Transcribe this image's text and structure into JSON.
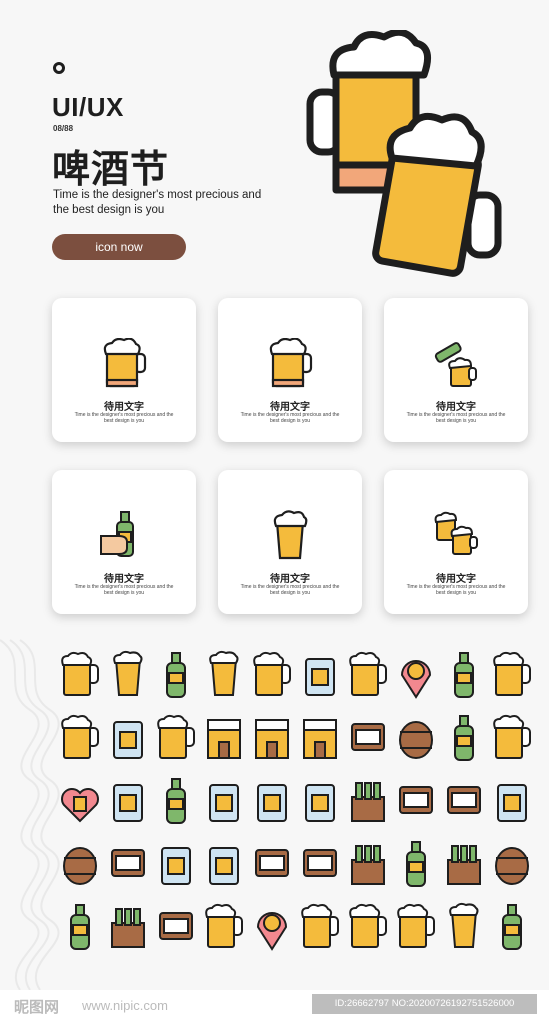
{
  "header": {
    "brand": "UI/UX",
    "count": "08/88",
    "title_cn": "啤酒节",
    "subtitle": "Time is the designer's most precious and the best design is you",
    "button_label": "icon now"
  },
  "cards": [
    {
      "icon": "beer-mug-icon",
      "title": "待用文字",
      "text": "Time is the designer's most precious and the best design is you"
    },
    {
      "icon": "beer-mug-icon",
      "title": "待用文字",
      "text": "Time is the designer's most precious and the best design is you"
    },
    {
      "icon": "bottle-pour-icon",
      "title": "待用文字",
      "text": "Time is the designer's most precious and the best design is you"
    },
    {
      "icon": "hand-bottle-icon",
      "title": "待用文字",
      "text": "Time is the designer's most precious and the best design is you"
    },
    {
      "icon": "beer-glass-icon",
      "title": "待用文字",
      "text": "Time is the designer's most precious and the best design is you"
    },
    {
      "icon": "cheers-icon",
      "title": "待用文字",
      "text": "Time is the designer's most precious and the best design is you"
    }
  ],
  "icon_grid": [
    [
      "beer-mug-icon",
      "tall-glass-icon",
      "bottle-icon",
      "goblet-icon",
      "beer-tap-icon",
      "ice-bucket-icon",
      "beer-mug-icon",
      "pint-glass-icon",
      "hand-bottle-icon",
      "cheers-icon"
    ],
    [
      "beer-taps-icon",
      "menu-card-icon",
      "table-beers-icon",
      "brewery-icon",
      "bar-counter-icon",
      "fridge-icon",
      "pub-building-icon",
      "barrel-icon",
      "can-bottle-icon",
      "toast-icon"
    ],
    [
      "heart-beer-icon",
      "calendar-icon",
      "pour-bottle-icon",
      "conveyor-icon",
      "drink-menu-icon",
      "party-music-icon",
      "bottle-basket-icon",
      "award-badge-icon",
      "pub-sign-icon",
      "hand-pour-icon"
    ],
    [
      "barrels-icon",
      "pub-badge-icon",
      "hops-icon",
      "grain-sack-icon",
      "pub-round-sign-icon",
      "pub-hanging-sign-icon",
      "bottle-crate-icon",
      "bottle-glass-icon",
      "bottle-box-icon",
      "barrel-cart-icon"
    ],
    [
      "bottle-burger-icon",
      "beer-stand-icon",
      "pub-board-icon",
      "many-mugs-icon",
      "location-pin-icon",
      "sausage-beer-icon",
      "tap-icon",
      "people-beer-icon",
      "glasses-icon",
      "wheat-bottle-icon"
    ]
  ],
  "footer": {
    "logo": "昵图网",
    "url": "www.nipic.com",
    "id_text": "ID:26662797 NO:20200726192751526000"
  },
  "colors": {
    "accent": "#7c4f3f",
    "beer": "#f4bb3c",
    "foam": "#ffffff",
    "outline": "#1e1e1e",
    "bottle": "#7fb76b",
    "wood": "#a86b45",
    "pink": "#f2888f"
  }
}
